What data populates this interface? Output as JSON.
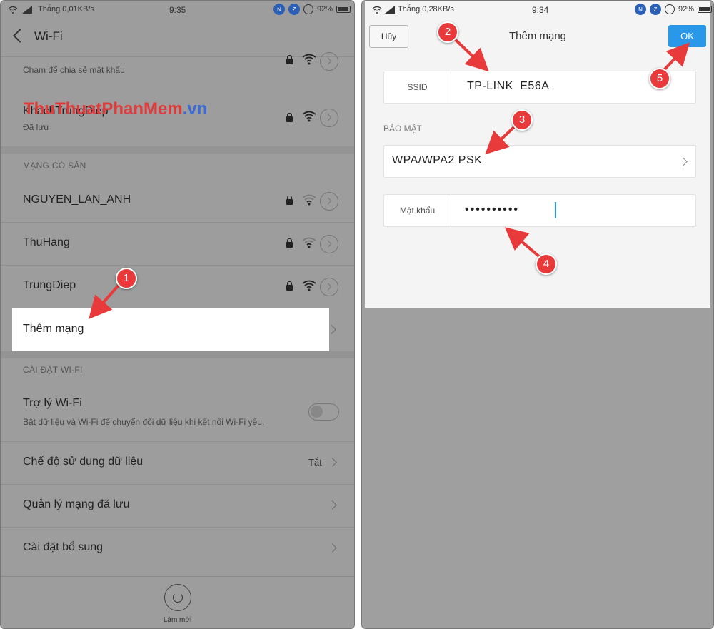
{
  "left": {
    "status": {
      "carrier": "Thắng",
      "speed": "0,01KB/s",
      "time": "9:35",
      "battery": "92%"
    },
    "header_title": "Wi-Fi",
    "watermark": {
      "part1": "ThuThuat",
      "part2": "PhanMem",
      "part3": ".vn"
    },
    "saved_networks": [
      {
        "name": "",
        "sub": "Chạm để chia sẻ mật khẩu"
      },
      {
        "name": "KhachTrungDiep",
        "sub": "Đã lưu"
      }
    ],
    "available_label": "MẠNG CÓ SẴN",
    "available_networks": [
      "NGUYEN_LAN_ANH",
      "ThuHang",
      "TrungDiep"
    ],
    "add_network": "Thêm mạng",
    "settings_label": "CÀI ĐẶT WI-FI",
    "wifi_assistant": {
      "title": "Trợ lý Wi-Fi",
      "desc": "Bật dữ liệu và Wi-Fi để chuyển đổi dữ liệu khi kết nối Wi-Fi yếu.",
      "enabled": false
    },
    "settings_rows": [
      {
        "label": "Chế độ sử dụng dữ liệu",
        "value": "Tắt"
      },
      {
        "label": "Quản lý mạng đã lưu",
        "value": ""
      },
      {
        "label": "Cài đặt bổ sung",
        "value": ""
      }
    ],
    "refresh_label": "Làm mới"
  },
  "right": {
    "status": {
      "carrier": "Thắng",
      "speed": "0,28KB/s",
      "time": "9:34",
      "battery": "92%"
    },
    "cancel": "Hủy",
    "title": "Thêm mạng",
    "ok": "OK",
    "ssid_label": "SSID",
    "ssid_value": "TP-LINK_E56A",
    "security_label": "BẢO MẬT",
    "security_value": "WPA/WPA2 PSK",
    "password_label": "Mật khẩu",
    "password_dots": "••••••••••"
  },
  "markers": [
    "1",
    "2",
    "3",
    "4",
    "5"
  ],
  "colors": {
    "accent_blue": "#2a98e8",
    "marker_red": "#e83a3a",
    "dim_overlay": "#9d9d9d"
  }
}
